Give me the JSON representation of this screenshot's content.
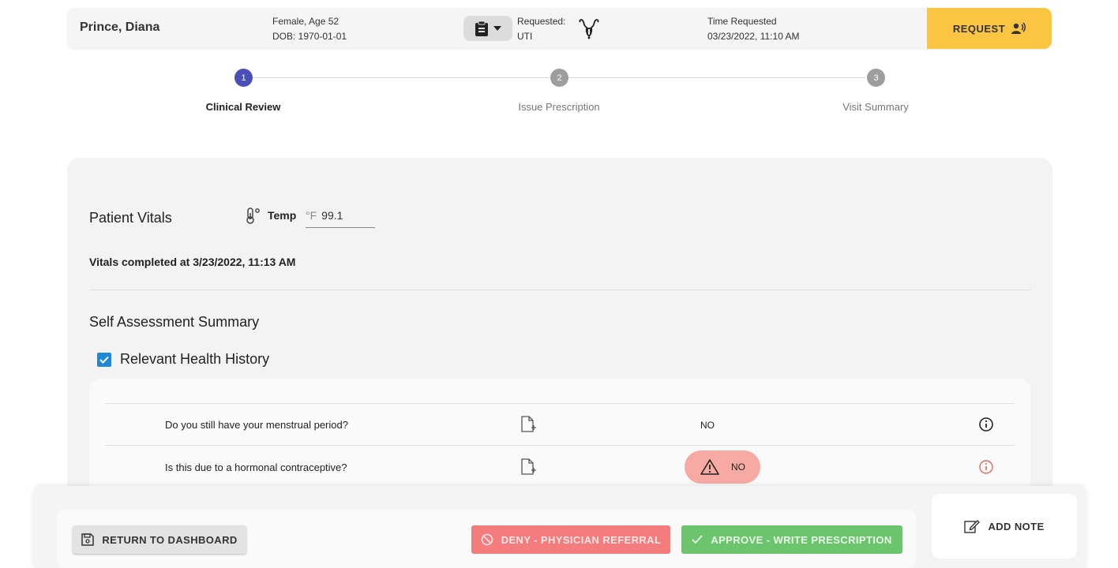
{
  "header": {
    "patient_name": "Prince, Diana",
    "sex_age": "Female, Age 52",
    "dob": "DOB: 1970-01-01",
    "requested_label": "Requested:",
    "requested_value": "UTI",
    "time_label": "Time Requested",
    "time_value": "03/23/2022, 11:10 AM",
    "request_button": "REQUEST"
  },
  "stepper": {
    "steps": [
      {
        "number": "1",
        "label": "Clinical Review",
        "active": true
      },
      {
        "number": "2",
        "label": "Issue Prescription",
        "active": false
      },
      {
        "number": "3",
        "label": "Visit Summary",
        "active": false
      }
    ],
    "active_color": "#4a4fb8",
    "inactive_color": "#9e9e9e"
  },
  "vitals": {
    "title": "Patient Vitals",
    "temp_label": "Temp",
    "temp_unit": "°F",
    "temp_value": "99.1",
    "completed_text": "Vitals completed at 3/23/2022, 11:13 AM"
  },
  "self_assessment": {
    "title": "Self Assessment Summary",
    "section_label": "Relevant Health History",
    "section_checked": true,
    "questions": [
      {
        "question": "Do you still have your menstrual period?",
        "answer": "NO",
        "flagged": false
      },
      {
        "question": "Is this due to a hormonal contraceptive?",
        "answer": "NO",
        "flagged": true
      }
    ]
  },
  "actions": {
    "return_label": "RETURN TO DASHBOARD",
    "deny_label": "DENY - PHYSICIAN REFERRAL",
    "approve_label": "APPROVE - WRITE PRESCRIPTION",
    "note_label": "ADD NOTE"
  },
  "colors": {
    "request": "#fbc443",
    "deny": "#f47c7c",
    "approve": "#6cc56c",
    "checkbox": "#1f88d8",
    "warning_pill": "#f7a9a4",
    "warning_info": "#e06a5e"
  }
}
